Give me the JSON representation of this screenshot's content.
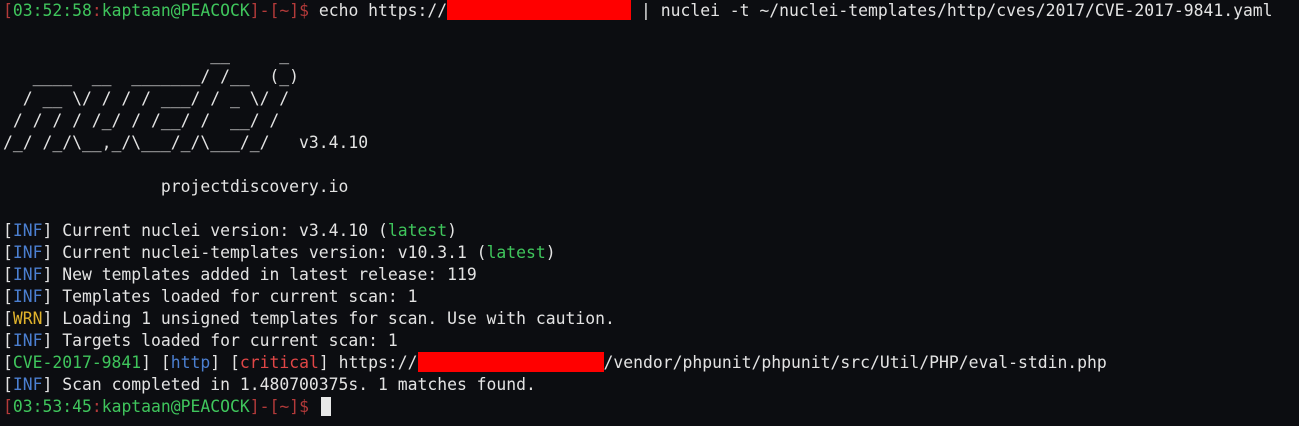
{
  "prompt1": {
    "lb": "[",
    "time": "03:52:58",
    "colon": ":",
    "user_host": "kaptaan@PEACOCK",
    "rb": "]",
    "dash": "-",
    "dir": "[~]",
    "dollar": "$",
    "cmd_before": " echo https://",
    "cmd_after": " | nuclei -t ~/nuclei-templates/http/cves/2017/CVE-2017-9841.yaml"
  },
  "banner": {
    "lines": [
      "                     __     _",
      "   ____  __  _______/ /__  (_)",
      "  / __ \\/ / / / ___/ / _ \\/ /",
      " / / / / /_/ / /__/ /  __/ /",
      "/_/ /_/\\__,_/\\___/_/\\___/_/   v3.4.10"
    ],
    "site": "                projectdiscovery.io"
  },
  "log": [
    {
      "tag": "INF",
      "kind": "inf",
      "text": " Current nuclei version: v3.4.10 (",
      "hl": "latest",
      "tail": ")"
    },
    {
      "tag": "INF",
      "kind": "inf",
      "text": " Current nuclei-templates version: v10.3.1 (",
      "hl": "latest",
      "tail": ")"
    },
    {
      "tag": "INF",
      "kind": "inf",
      "text": " New templates added in latest release: 119"
    },
    {
      "tag": "INF",
      "kind": "inf",
      "text": " Templates loaded for current scan: 1"
    },
    {
      "tag": "WRN",
      "kind": "wrn",
      "text": " Loading 1 unsigned templates for scan. Use with caution."
    },
    {
      "tag": "INF",
      "kind": "inf",
      "text": " Targets loaded for current scan: 1"
    }
  ],
  "result": {
    "cve": "CVE-2017-9841",
    "protocol": "http",
    "severity": "critical",
    "url_before": " https://",
    "url_after": "/vendor/phpunit/phpunit/src/Util/PHP/eval-stdin.php"
  },
  "done": {
    "tag": "INF",
    "text": " Scan completed in 1.480700375s. 1 matches found."
  },
  "prompt2": {
    "lb": "[",
    "time": "03:53:45",
    "colon": ":",
    "user_host": "kaptaan@PEACOCK",
    "rb": "]",
    "dash": "-",
    "dir": "[~]",
    "dollar": "$"
  },
  "colors": {
    "background": "#0c0d11",
    "text": "#e3e3e3",
    "prompt_bracket": "#b33a3a",
    "prompt_time": "#3fc55c",
    "inf": "#4b7fd1",
    "wrn": "#e0b32c",
    "critical": "#e04646",
    "redaction": "#ff0000"
  }
}
